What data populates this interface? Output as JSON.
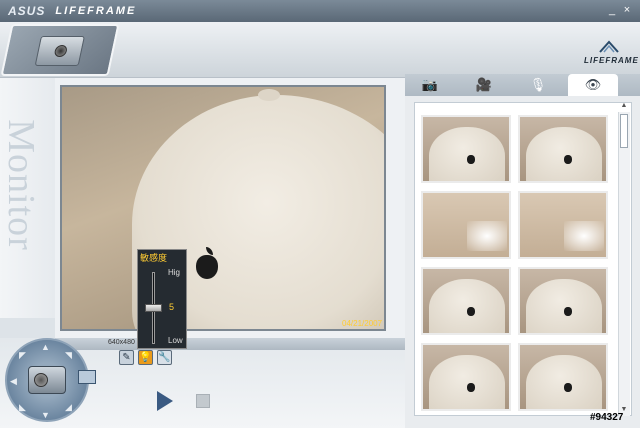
{
  "window": {
    "brand": "ASUS",
    "app_name": "LIFEFRAME",
    "minimize_label": "_",
    "close_label": "×"
  },
  "header": {
    "logo_text": "LIFEFRAME"
  },
  "monitor": {
    "side_label": "Monitor",
    "timestamp": "04/21/2007",
    "resolution": "640x480"
  },
  "sensitivity": {
    "title": "敏感度",
    "high_label": "Hig",
    "low_label": "Low",
    "value": "5",
    "level_fraction": 0.5
  },
  "toolbar": {
    "icons": [
      "pen-icon",
      "bulb-icon",
      "wrench-icon"
    ]
  },
  "tabs": [
    {
      "name": "photo",
      "icon": "camera-icon",
      "glyph": "📷"
    },
    {
      "name": "video",
      "icon": "video-camera-icon",
      "glyph": "🎥"
    },
    {
      "name": "audio",
      "icon": "microphone-icon",
      "glyph": "🎙"
    },
    {
      "name": "monitor",
      "icon": "eye-icon",
      "glyph": "👁",
      "active": true
    }
  ],
  "thumbnails": [
    {
      "kind": "cap"
    },
    {
      "kind": "cap"
    },
    {
      "kind": "wall"
    },
    {
      "kind": "wall"
    },
    {
      "kind": "cap"
    },
    {
      "kind": "cap"
    },
    {
      "kind": "cap"
    },
    {
      "kind": "cap"
    }
  ],
  "playback": {
    "play_icon": "play-icon",
    "stop_icon": "stop-icon"
  },
  "watermark": "#94327",
  "colors": {
    "accent": "#e99a1b",
    "timestamp": "#ffcc33",
    "play": "#3a5a82"
  }
}
